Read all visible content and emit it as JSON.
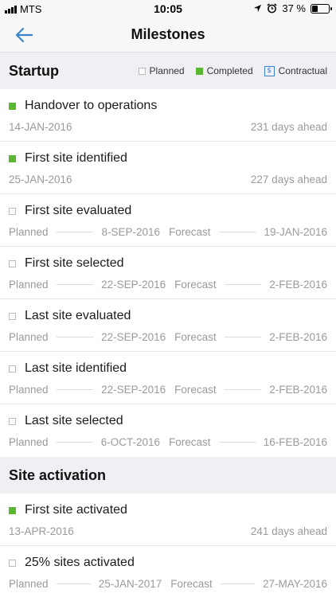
{
  "status": {
    "carrier": "MTS",
    "time": "10:05",
    "battery": "37 %",
    "battery_level": 0.37
  },
  "nav": {
    "title": "Milestones",
    "back_icon": "arrow-left-icon"
  },
  "legend": {
    "planned": "Planned",
    "completed": "Completed",
    "contractual": "Contractual",
    "contractual_symbol": "$"
  },
  "sections": [
    {
      "title": "Startup",
      "items": [
        {
          "name": "Handover to operations",
          "status": "completed",
          "date": "14-JAN-2016",
          "ahead": "231 days ahead"
        },
        {
          "name": "First site identified",
          "status": "completed",
          "date": "25-JAN-2016",
          "ahead": "227 days ahead"
        },
        {
          "name": "First site evaluated",
          "status": "planned",
          "planned_label": "Planned",
          "planned_date": "8-SEP-2016",
          "forecast_label": "Forecast",
          "forecast_date": "19-JAN-2016"
        },
        {
          "name": "First site selected",
          "status": "planned",
          "planned_label": "Planned",
          "planned_date": "22-SEP-2016",
          "forecast_label": "Forecast",
          "forecast_date": "2-FEB-2016"
        },
        {
          "name": "Last site evaluated",
          "status": "planned",
          "planned_label": "Planned",
          "planned_date": "22-SEP-2016",
          "forecast_label": "Forecast",
          "forecast_date": "2-FEB-2016"
        },
        {
          "name": "Last site identified",
          "status": "planned",
          "planned_label": "Planned",
          "planned_date": "22-SEP-2016",
          "forecast_label": "Forecast",
          "forecast_date": "2-FEB-2016"
        },
        {
          "name": "Last site selected",
          "status": "planned",
          "planned_label": "Planned",
          "planned_date": "6-OCT-2016",
          "forecast_label": "Forecast",
          "forecast_date": "16-FEB-2016"
        }
      ]
    },
    {
      "title": "Site activation",
      "items": [
        {
          "name": "First site activated",
          "status": "completed",
          "date": "13-APR-2016",
          "ahead": "241 days ahead"
        },
        {
          "name": "25% sites activated",
          "status": "planned",
          "planned_label": "Planned",
          "planned_date": "25-JAN-2017",
          "forecast_label": "Forecast",
          "forecast_date": "27-MAY-2016"
        }
      ]
    }
  ],
  "colors": {
    "accent": "#3c83c8",
    "completed": "#5bb731",
    "section_bg": "#efeff4"
  }
}
